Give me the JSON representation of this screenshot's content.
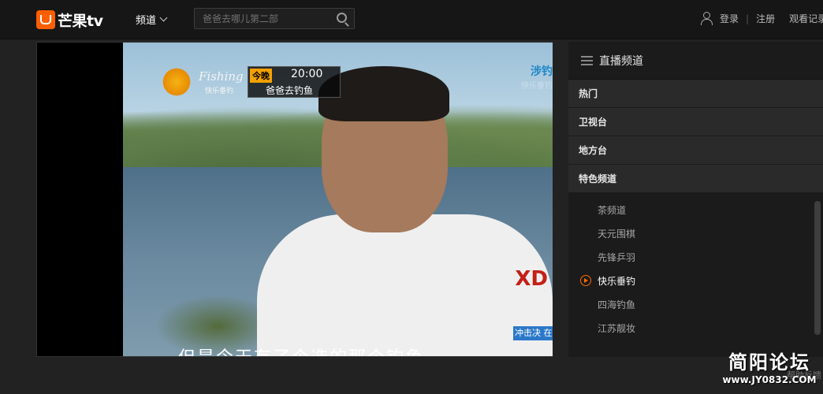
{
  "header": {
    "logo_text": "芒果tv",
    "channel_nav": "频道",
    "search_placeholder": "爸爸去哪儿第二部",
    "login": "登录",
    "register": "注册",
    "history": "观看记录"
  },
  "video": {
    "tonight_label": "今晚",
    "air_time": "20:00",
    "program_name": "爸爸去钓鱼",
    "channel_brand": "Fishing",
    "channel_brand_sub": "快乐垂钓",
    "right_tag": "涉钓",
    "right_tag_sub": "快乐垂钓",
    "corner_promo": "冲击决 在此一",
    "subtitle": "但是今天有了个选的那个钓鱼",
    "jersey_logo": "XD"
  },
  "sidebar": {
    "title": "直播频道",
    "categories": [
      "热门",
      "卫视台",
      "地方台",
      "特色频道"
    ],
    "sub_items": [
      {
        "label": "茶频道",
        "active": false
      },
      {
        "label": "天元围棋",
        "active": false
      },
      {
        "label": "先锋乒羽",
        "active": false
      },
      {
        "label": "快乐垂钓",
        "active": true
      },
      {
        "label": "四海钓鱼",
        "active": false
      },
      {
        "label": "江苏靓妆",
        "active": false
      }
    ]
  },
  "watermark": {
    "title": "简阳论坛",
    "url": "www.JY0832.COM",
    "hidden_text": "帮助反馈"
  },
  "colors": {
    "accent": "#ff6a00",
    "brand": "#ff5f00",
    "background": "#222223"
  }
}
